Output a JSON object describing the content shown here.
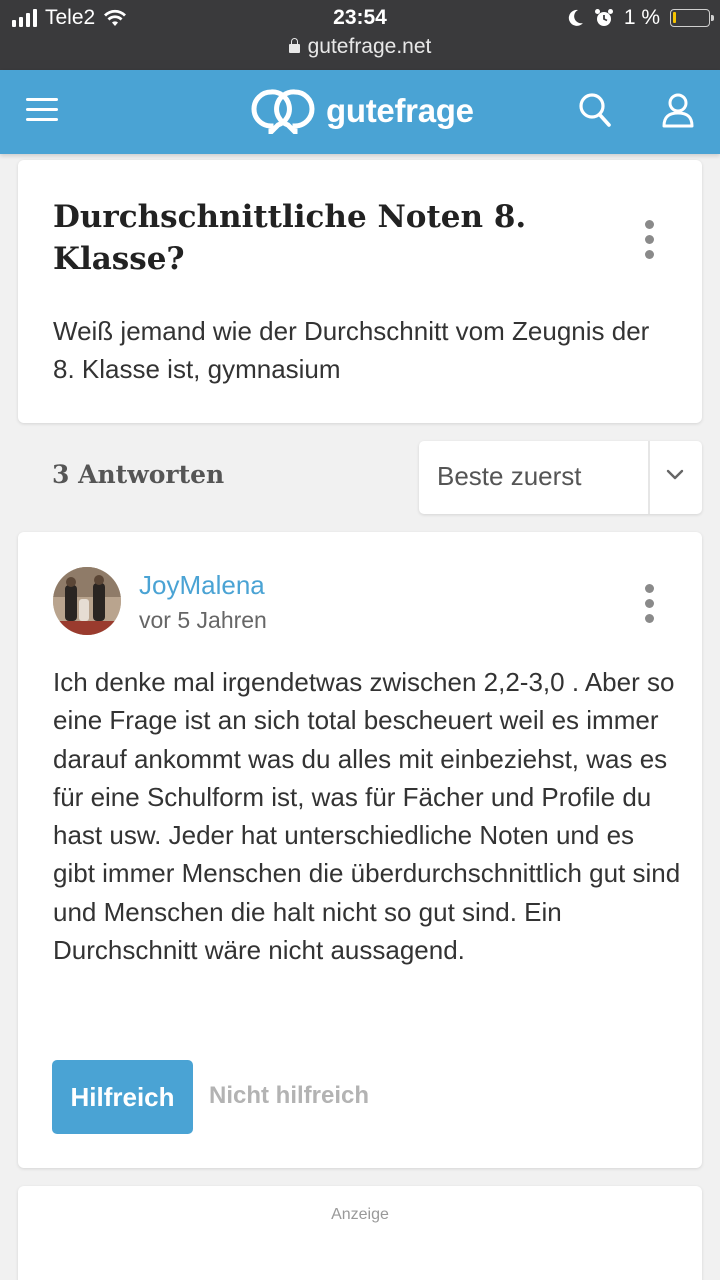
{
  "status_bar": {
    "carrier": "Tele2",
    "time": "23:54",
    "url": "gutefrage.net",
    "battery": "1 %",
    "battery_level": 0.01
  },
  "header": {
    "logo_text": "gutefrage",
    "brand_color": "#4aa3d4",
    "icons": [
      "menu-icon",
      "search-icon",
      "user-icon"
    ]
  },
  "question": {
    "title": "Durchschnittliche Noten 8. Klasse?",
    "body": "Weiß jemand wie der Durchschnitt vom Zeugnis der 8. Klasse ist, gymnasium"
  },
  "answers": {
    "count_label": "3 Antworten",
    "sort_selected": "Beste zuerst"
  },
  "answer": {
    "author": "JoyMalena",
    "time": "vor 5 Jahren",
    "body": "Ich denke mal irgendetwas zwischen 2,2-3,0 . Aber so eine Frage ist an sich total bescheuert weil es immer darauf ankommt was du alles mit einbeziehst, was es für eine Schulform ist, was für Fächer und Profile du hast usw. Jeder hat unterschiedliche Noten und es gibt immer Menschen die überdurchschnittlich gut sind und Menschen die halt nicht so gut sind. Ein Durchschnitt wäre nicht aussagend.",
    "helpful_label": "Hilfreich",
    "not_helpful_label": "Nicht hilfreich"
  },
  "ad": {
    "label": "Anzeige"
  }
}
